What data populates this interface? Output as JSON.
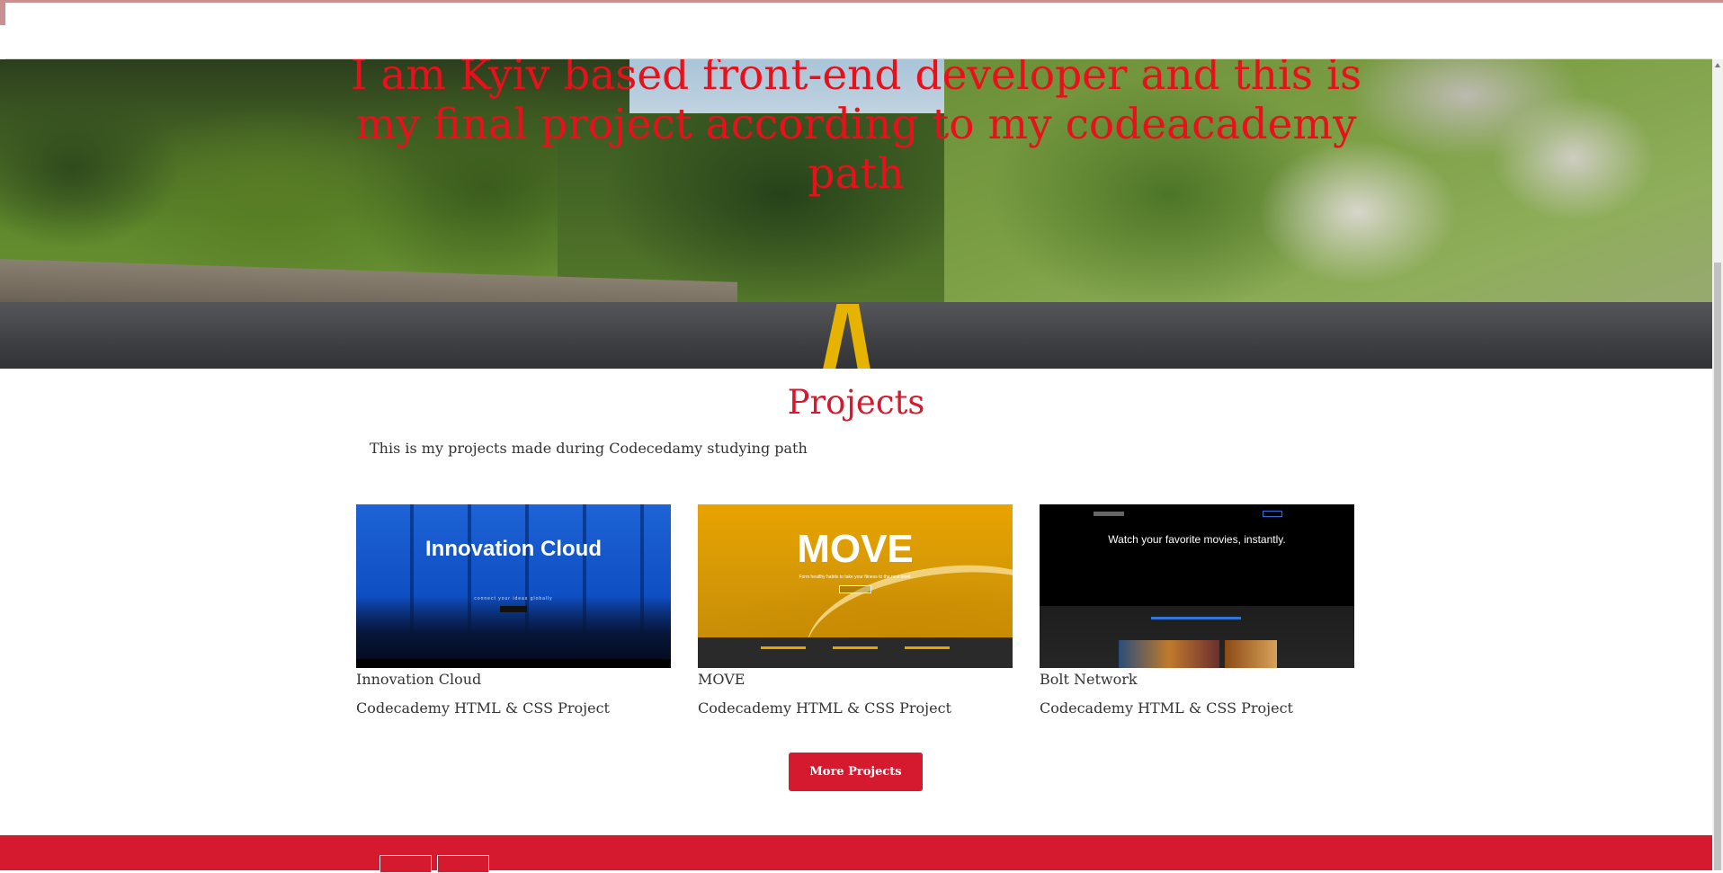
{
  "hero": {
    "title": "I am Kyiv based front-end developer and this is my final project according to my codeacademy path"
  },
  "projects": {
    "heading": "Projects",
    "intro": "This is my projects made during Codecedamy studying path",
    "cards": [
      {
        "title": "Innovation Cloud",
        "subtitle": "Codecademy HTML & CSS Project",
        "thumb_text": "Innovation Cloud",
        "thumb_tagline": "connect your ideas globally"
      },
      {
        "title": "MOVE",
        "subtitle": "Codecademy HTML & CSS Project",
        "thumb_text": "MOVE",
        "thumb_tagline": "Form healthy habits to take your fitness to the next level."
      },
      {
        "title": "Bolt Network",
        "subtitle": "Codecademy HTML & CSS Project",
        "thumb_text": "Watch your favorite movies, instantly."
      }
    ],
    "more_button": "More Projects"
  },
  "footer": {
    "icons": [
      "broken-image-icon",
      "broken-image-icon"
    ]
  },
  "colors": {
    "accent": "#d51a30",
    "hero_title": "#e8101a",
    "text": "#333333"
  }
}
